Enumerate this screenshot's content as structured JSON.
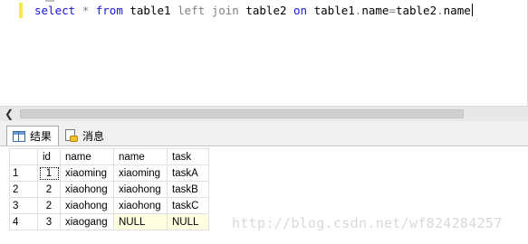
{
  "editor": {
    "query_tokens": [
      {
        "text": "select",
        "kind": "kw"
      },
      {
        "text": " ",
        "kind": "tx"
      },
      {
        "text": "*",
        "kind": "op"
      },
      {
        "text": " ",
        "kind": "tx"
      },
      {
        "text": "from",
        "kind": "kw"
      },
      {
        "text": " table1 ",
        "kind": "tx"
      },
      {
        "text": "left join",
        "kind": "op"
      },
      {
        "text": " table2 ",
        "kind": "tx"
      },
      {
        "text": "on",
        "kind": "kw"
      },
      {
        "text": " table1",
        "kind": "tx"
      },
      {
        "text": ".",
        "kind": "op"
      },
      {
        "text": "name",
        "kind": "tx"
      },
      {
        "text": "=",
        "kind": "op"
      },
      {
        "text": "table2",
        "kind": "tx"
      },
      {
        "text": ".",
        "kind": "op"
      },
      {
        "text": "name",
        "kind": "tx"
      }
    ]
  },
  "tabs": {
    "results_label": "结果",
    "messages_label": "消息"
  },
  "grid": {
    "columns": [
      "id",
      "name",
      "name",
      "task"
    ],
    "rows": [
      {
        "num": "1",
        "id": "1",
        "name": "xiaoming",
        "name2": "xiaoming",
        "task": "taskA"
      },
      {
        "num": "2",
        "id": "2",
        "name": "xiaohong",
        "name2": "xiaohong",
        "task": "taskB"
      },
      {
        "num": "3",
        "id": "2",
        "name": "xiaohong",
        "name2": "xiaohong",
        "task": "taskC"
      },
      {
        "num": "4",
        "id": "3",
        "name": "xiaogang",
        "name2": "NULL",
        "task": "NULL"
      }
    ]
  },
  "watermark": "http://blog.csdn.net/wf824284257",
  "colors": {
    "keyword": "#1414e0",
    "operator": "#808080",
    "null_cell_bg": "#ffffe1",
    "change_bar": "#f5e94c"
  }
}
